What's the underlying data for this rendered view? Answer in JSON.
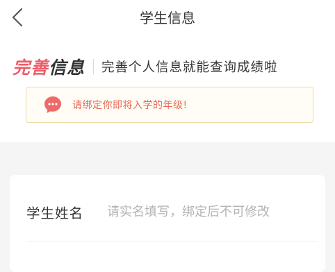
{
  "nav": {
    "title": "学生信息"
  },
  "banner": {
    "brand_part1": "完善",
    "brand_part2": "信息",
    "subtitle": "完善个人信息就能查询成绩啦"
  },
  "notice": {
    "text": "请绑定你即将入学的年级!",
    "icon": "chat-bubble-icon"
  },
  "form": {
    "name_field": {
      "label": "学生姓名",
      "value": "",
      "placeholder": "请实名填写，绑定后不可修改"
    }
  },
  "colors": {
    "accent_red": "#ee5d68",
    "notice_border": "#ecd9a4",
    "notice_text": "#e86a55"
  }
}
